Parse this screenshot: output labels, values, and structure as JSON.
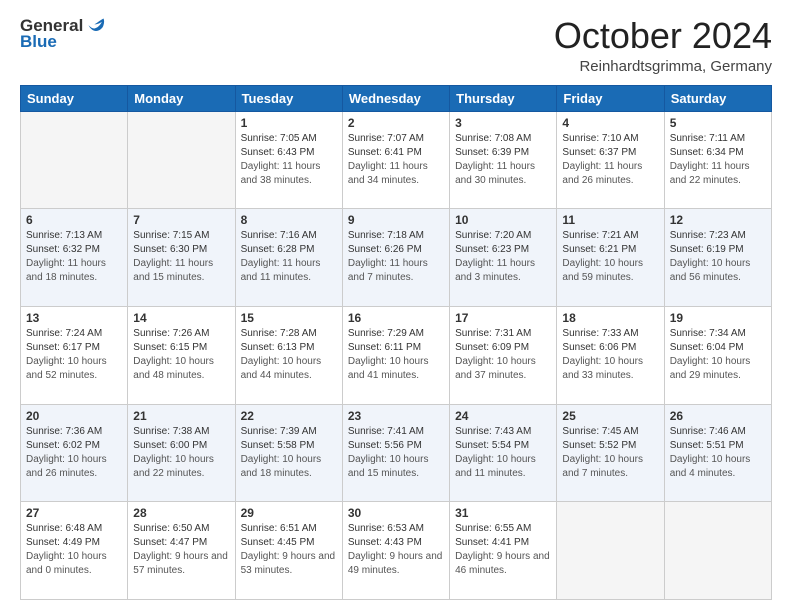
{
  "logo": {
    "general": "General",
    "blue": "Blue"
  },
  "header": {
    "month": "October 2024",
    "location": "Reinhardtsgrimma, Germany"
  },
  "weekdays": [
    "Sunday",
    "Monday",
    "Tuesday",
    "Wednesday",
    "Thursday",
    "Friday",
    "Saturday"
  ],
  "weeks": [
    [
      {
        "day": null
      },
      {
        "day": null
      },
      {
        "day": "1",
        "sunrise": "7:05 AM",
        "sunset": "6:43 PM",
        "daylight": "11 hours and 38 minutes."
      },
      {
        "day": "2",
        "sunrise": "7:07 AM",
        "sunset": "6:41 PM",
        "daylight": "11 hours and 34 minutes."
      },
      {
        "day": "3",
        "sunrise": "7:08 AM",
        "sunset": "6:39 PM",
        "daylight": "11 hours and 30 minutes."
      },
      {
        "day": "4",
        "sunrise": "7:10 AM",
        "sunset": "6:37 PM",
        "daylight": "11 hours and 26 minutes."
      },
      {
        "day": "5",
        "sunrise": "7:11 AM",
        "sunset": "6:34 PM",
        "daylight": "11 hours and 22 minutes."
      }
    ],
    [
      {
        "day": "6",
        "sunrise": "7:13 AM",
        "sunset": "6:32 PM",
        "daylight": "11 hours and 18 minutes."
      },
      {
        "day": "7",
        "sunrise": "7:15 AM",
        "sunset": "6:30 PM",
        "daylight": "11 hours and 15 minutes."
      },
      {
        "day": "8",
        "sunrise": "7:16 AM",
        "sunset": "6:28 PM",
        "daylight": "11 hours and 11 minutes."
      },
      {
        "day": "9",
        "sunrise": "7:18 AM",
        "sunset": "6:26 PM",
        "daylight": "11 hours and 7 minutes."
      },
      {
        "day": "10",
        "sunrise": "7:20 AM",
        "sunset": "6:23 PM",
        "daylight": "11 hours and 3 minutes."
      },
      {
        "day": "11",
        "sunrise": "7:21 AM",
        "sunset": "6:21 PM",
        "daylight": "10 hours and 59 minutes."
      },
      {
        "day": "12",
        "sunrise": "7:23 AM",
        "sunset": "6:19 PM",
        "daylight": "10 hours and 56 minutes."
      }
    ],
    [
      {
        "day": "13",
        "sunrise": "7:24 AM",
        "sunset": "6:17 PM",
        "daylight": "10 hours and 52 minutes."
      },
      {
        "day": "14",
        "sunrise": "7:26 AM",
        "sunset": "6:15 PM",
        "daylight": "10 hours and 48 minutes."
      },
      {
        "day": "15",
        "sunrise": "7:28 AM",
        "sunset": "6:13 PM",
        "daylight": "10 hours and 44 minutes."
      },
      {
        "day": "16",
        "sunrise": "7:29 AM",
        "sunset": "6:11 PM",
        "daylight": "10 hours and 41 minutes."
      },
      {
        "day": "17",
        "sunrise": "7:31 AM",
        "sunset": "6:09 PM",
        "daylight": "10 hours and 37 minutes."
      },
      {
        "day": "18",
        "sunrise": "7:33 AM",
        "sunset": "6:06 PM",
        "daylight": "10 hours and 33 minutes."
      },
      {
        "day": "19",
        "sunrise": "7:34 AM",
        "sunset": "6:04 PM",
        "daylight": "10 hours and 29 minutes."
      }
    ],
    [
      {
        "day": "20",
        "sunrise": "7:36 AM",
        "sunset": "6:02 PM",
        "daylight": "10 hours and 26 minutes."
      },
      {
        "day": "21",
        "sunrise": "7:38 AM",
        "sunset": "6:00 PM",
        "daylight": "10 hours and 22 minutes."
      },
      {
        "day": "22",
        "sunrise": "7:39 AM",
        "sunset": "5:58 PM",
        "daylight": "10 hours and 18 minutes."
      },
      {
        "day": "23",
        "sunrise": "7:41 AM",
        "sunset": "5:56 PM",
        "daylight": "10 hours and 15 minutes."
      },
      {
        "day": "24",
        "sunrise": "7:43 AM",
        "sunset": "5:54 PM",
        "daylight": "10 hours and 11 minutes."
      },
      {
        "day": "25",
        "sunrise": "7:45 AM",
        "sunset": "5:52 PM",
        "daylight": "10 hours and 7 minutes."
      },
      {
        "day": "26",
        "sunrise": "7:46 AM",
        "sunset": "5:51 PM",
        "daylight": "10 hours and 4 minutes."
      }
    ],
    [
      {
        "day": "27",
        "sunrise": "6:48 AM",
        "sunset": "4:49 PM",
        "daylight": "10 hours and 0 minutes."
      },
      {
        "day": "28",
        "sunrise": "6:50 AM",
        "sunset": "4:47 PM",
        "daylight": "9 hours and 57 minutes."
      },
      {
        "day": "29",
        "sunrise": "6:51 AM",
        "sunset": "4:45 PM",
        "daylight": "9 hours and 53 minutes."
      },
      {
        "day": "30",
        "sunrise": "6:53 AM",
        "sunset": "4:43 PM",
        "daylight": "9 hours and 49 minutes."
      },
      {
        "day": "31",
        "sunrise": "6:55 AM",
        "sunset": "4:41 PM",
        "daylight": "9 hours and 46 minutes."
      },
      {
        "day": null
      },
      {
        "day": null
      }
    ]
  ],
  "labels": {
    "sunrise_prefix": "Sunrise: ",
    "sunset_prefix": "Sunset: ",
    "daylight_prefix": "Daylight: "
  }
}
